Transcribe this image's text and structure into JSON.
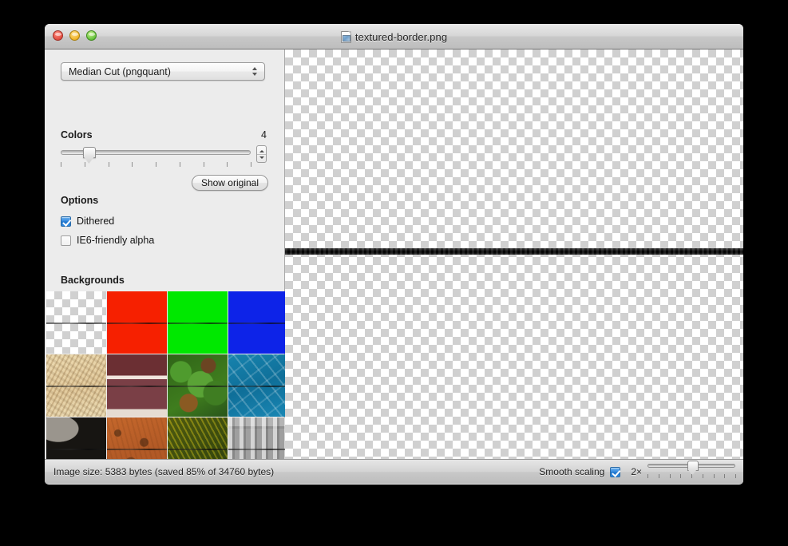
{
  "window": {
    "title": "textured-border.png",
    "title_icon": "png-document-icon",
    "traffic_lights": [
      {
        "name": "close",
        "color": "#e24b40"
      },
      {
        "name": "minimize",
        "color": "#f0b429"
      },
      {
        "name": "zoom",
        "color": "#63c13c"
      }
    ]
  },
  "sidebar": {
    "quantizer": {
      "selected": "Median Cut (pngquant)",
      "options": [
        "Median Cut (pngquant)"
      ]
    },
    "colors": {
      "label": "Colors",
      "value": "4",
      "slider_percent": 15,
      "tick_count": 9,
      "stepper": "colors-stepper"
    },
    "show_original_label": "Show original",
    "options": {
      "heading": "Options",
      "items": [
        {
          "label": "Dithered",
          "checked": true
        },
        {
          "label": "IE6-friendly alpha",
          "checked": false
        }
      ]
    },
    "backgrounds": {
      "heading": "Backgrounds",
      "swatches": [
        {
          "name": "transparent-checker",
          "style": "checker",
          "label": "Transparent"
        },
        {
          "name": "red",
          "style": "red",
          "color": "#f62000",
          "label": "Red"
        },
        {
          "name": "green",
          "style": "green",
          "color": "#00e800",
          "label": "Green"
        },
        {
          "name": "blue",
          "style": "blue",
          "color": "#0d23e8",
          "label": "Blue"
        },
        {
          "name": "sand-texture",
          "style": "sand",
          "label": "Sand"
        },
        {
          "name": "brick-red-texture",
          "style": "brickred",
          "label": "Brick"
        },
        {
          "name": "green-leaves-texture",
          "style": "leaves",
          "label": "Leaves"
        },
        {
          "name": "cyan-ice-texture",
          "style": "cyanice",
          "label": "Ice"
        },
        {
          "name": "stone-wall-texture",
          "style": "stone",
          "label": "Stone"
        },
        {
          "name": "rust-clay-texture",
          "style": "rust",
          "label": "Rust"
        },
        {
          "name": "dark-moss-texture",
          "style": "moss",
          "label": "Moss"
        },
        {
          "name": "gray-metal-texture",
          "style": "metal",
          "label": "Metal"
        }
      ]
    }
  },
  "canvas": {
    "background": "transparent-checkerboard",
    "content": "horizontal-textured-dark-border-line"
  },
  "statusbar": {
    "image_size_text": "Image size: 5383 bytes (saved 85% of 34760 bytes)",
    "smooth_scaling_label": "Smooth scaling",
    "smooth_scaling_checked": true,
    "zoom_label": "2×",
    "zoom_slider_percent": 52,
    "zoom_tick_count": 9
  }
}
